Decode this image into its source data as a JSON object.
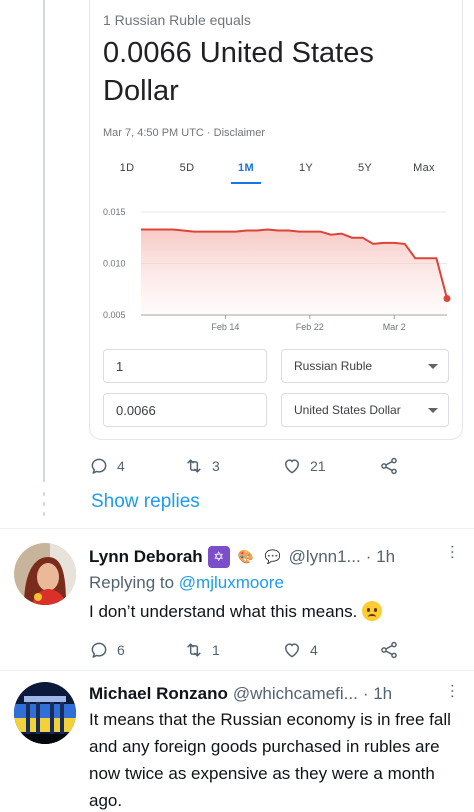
{
  "converter": {
    "label": "1 Russian Ruble equals",
    "value": "0.0066 United States Dollar",
    "timestamp": "Mar 7, 4:50 PM UTC · Disclaimer",
    "tabs": [
      "1D",
      "5D",
      "1M",
      "1Y",
      "5Y",
      "Max"
    ],
    "active_tab": "1M",
    "amount_from": "1",
    "currency_from": "Russian Ruble",
    "amount_to": "0.0066",
    "currency_to": "United States Dollar",
    "line_color": "#db4437"
  },
  "chart_data": {
    "type": "line",
    "xlabel": "",
    "ylabel": "",
    "y_ticks": [
      "0.015",
      "0.010",
      "0.005"
    ],
    "x_ticks": [
      "Feb 14",
      "Feb 22",
      "Mar 2"
    ],
    "ylim": [
      0.005,
      0.015
    ],
    "x": [
      "Feb 6",
      "Feb 7",
      "Feb 8",
      "Feb 9",
      "Feb 10",
      "Feb 11",
      "Feb 12",
      "Feb 13",
      "Feb 14",
      "Feb 15",
      "Feb 16",
      "Feb 17",
      "Feb 18",
      "Feb 19",
      "Feb 20",
      "Feb 21",
      "Feb 22",
      "Feb 23",
      "Feb 24",
      "Feb 25",
      "Feb 26",
      "Feb 27",
      "Feb 28",
      "Mar 1",
      "Mar 2",
      "Mar 3",
      "Mar 4",
      "Mar 5",
      "Mar 6",
      "Mar 7"
    ],
    "series": [
      {
        "values": [
          0.0133,
          0.0133,
          0.0133,
          0.0133,
          0.0132,
          0.0131,
          0.0131,
          0.0131,
          0.0131,
          0.0131,
          0.0132,
          0.0132,
          0.0133,
          0.0132,
          0.0132,
          0.0131,
          0.0131,
          0.0131,
          0.0128,
          0.0129,
          0.0125,
          0.0125,
          0.0119,
          0.012,
          0.012,
          0.0119,
          0.0105,
          0.0105,
          0.0105,
          0.0066
        ]
      }
    ]
  },
  "actions": {
    "reply_count": "4",
    "retweet_count": "3",
    "like_count": "21"
  },
  "show_replies": "Show replies",
  "reply1": {
    "name": "Lynn Deborah",
    "badges": [
      "✡",
      "🎨",
      "💬"
    ],
    "handle": "@lynn1...",
    "time": "· 1h",
    "replying_prefix": "Replying to ",
    "replying_to": "@mjluxmoore",
    "text": "I don’t understand what this means.",
    "emoji_icon": "worried-face-icon",
    "reply_count": "6",
    "retweet_count": "1",
    "like_count": "4"
  },
  "reply2": {
    "name": "Michael Ronzano",
    "handle": "@whichcamefi...",
    "time": "· 1h",
    "text": "It means that the Russian economy is in free fall and any foreign goods purchased in rubles are now twice as expensive as they were a month ago."
  }
}
